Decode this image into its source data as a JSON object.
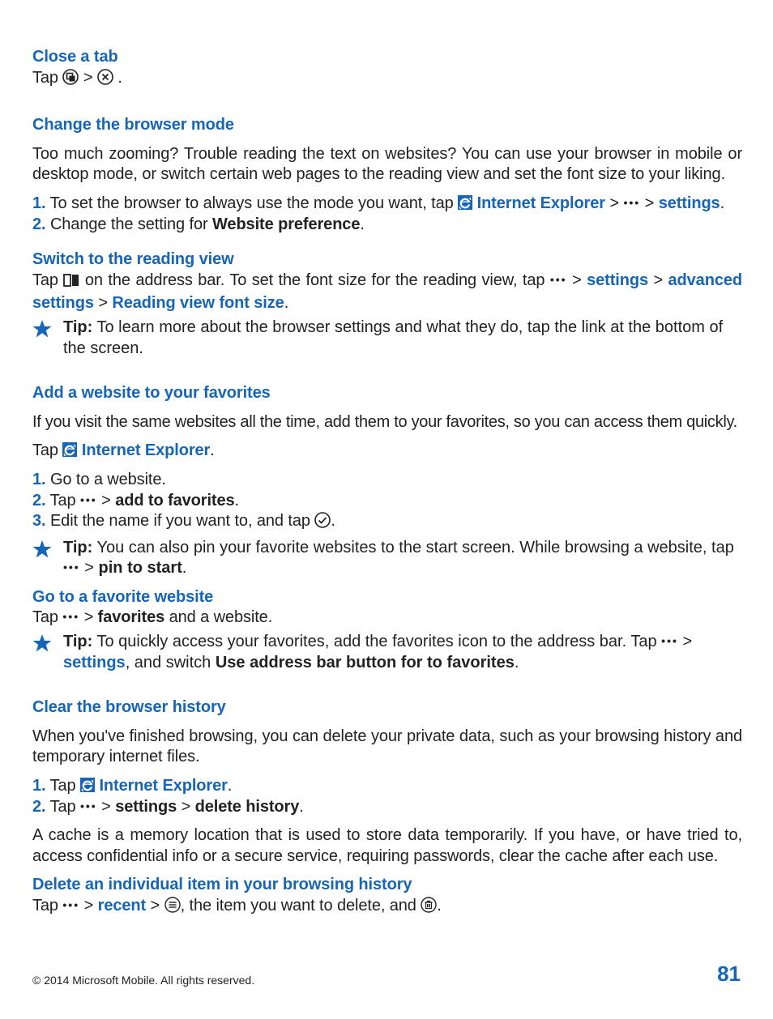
{
  "s1": {
    "title": "Close a tab",
    "line_a": "Tap ",
    "line_b": " > ",
    "line_c": "."
  },
  "s2": {
    "title": "Change the browser mode",
    "intro": "Too much zooming? Trouble reading the text on websites? You can use your browser in mobile or desktop mode, or switch certain web pages to the reading view and set the font size to your liking.",
    "step1a": "1.",
    "step1b": " To set the browser to always use the mode you want, tap ",
    "ie": "Internet Explorer",
    "gt": " > ",
    "settings": "settings",
    "period": ".",
    "step2a": "2.",
    "step2b": " Change the setting for ",
    "wpref": "Website preference"
  },
  "s3": {
    "title": "Switch to the reading view",
    "a": "Tap ",
    "b": " on the address bar. To set the font size for the reading view, tap ",
    "settings": "settings",
    "gt": " > ",
    "adv": "advanced settings",
    "rv": "Reading view font size",
    "period": ".",
    "tip_label": "Tip:",
    "tip_body": " To learn more about the browser settings and what they do, tap the link at the bottom of the screen."
  },
  "s4": {
    "title": "Add a website to your favorites",
    "intro": "If you visit the same websites all the time, add them to your favorites, so you can access them quickly.",
    "tap": "Tap ",
    "ie": "Internet Explorer",
    "period": ".",
    "l1n": "1.",
    "l1": " Go to a website.",
    "l2n": "2.",
    "l2a": " Tap ",
    "l2b": " > ",
    "l2c": "add to favorites",
    "l2d": ".",
    "l3n": "3.",
    "l3a": " Edit the name if you want to, and tap ",
    "l3b": ".",
    "tip1_label": "Tip:",
    "tip1_a": " You can also pin your favorite websites to the start screen. While browsing a website, tap ",
    "tip1_b": " > ",
    "tip1_c": "pin to start",
    "tip1_d": "."
  },
  "s5": {
    "title": "Go to a favorite website",
    "a": "Tap ",
    "b": " > ",
    "c": "favorites",
    "d": " and a website.",
    "tip_label": "Tip:",
    "tip_a": " To quickly access your favorites, add the favorites icon to the address bar. Tap ",
    "tip_b": " > ",
    "tip_c": "settings",
    "tip_d": ", and switch ",
    "tip_e": "Use address bar button for to favorites",
    "tip_f": "."
  },
  "s6": {
    "title": "Clear the browser history",
    "intro": "When you've finished browsing, you can delete your private data, such as your browsing history and temporary internet files.",
    "l1n": "1.",
    "l1a": " Tap ",
    "ie": "Internet Explorer",
    "l1b": ".",
    "l2n": "2.",
    "l2a": " Tap ",
    "l2b": " > ",
    "l2c": "settings",
    "l2d": " > ",
    "l2e": "delete history",
    "l2f": ".",
    "cache": "A cache is a memory location that is used to store data temporarily. If you have, or have tried to, access confidential info or a secure service, requiring passwords, clear the cache after each use."
  },
  "s7": {
    "title": "Delete an individual item in your browsing history",
    "a": "Tap ",
    "b": " > ",
    "c": "recent",
    "d": " > ",
    "e": ", the item you want to delete, and ",
    "f": "."
  },
  "footer": {
    "copy": "© 2014 Microsoft Mobile. All rights reserved.",
    "page": "81"
  }
}
